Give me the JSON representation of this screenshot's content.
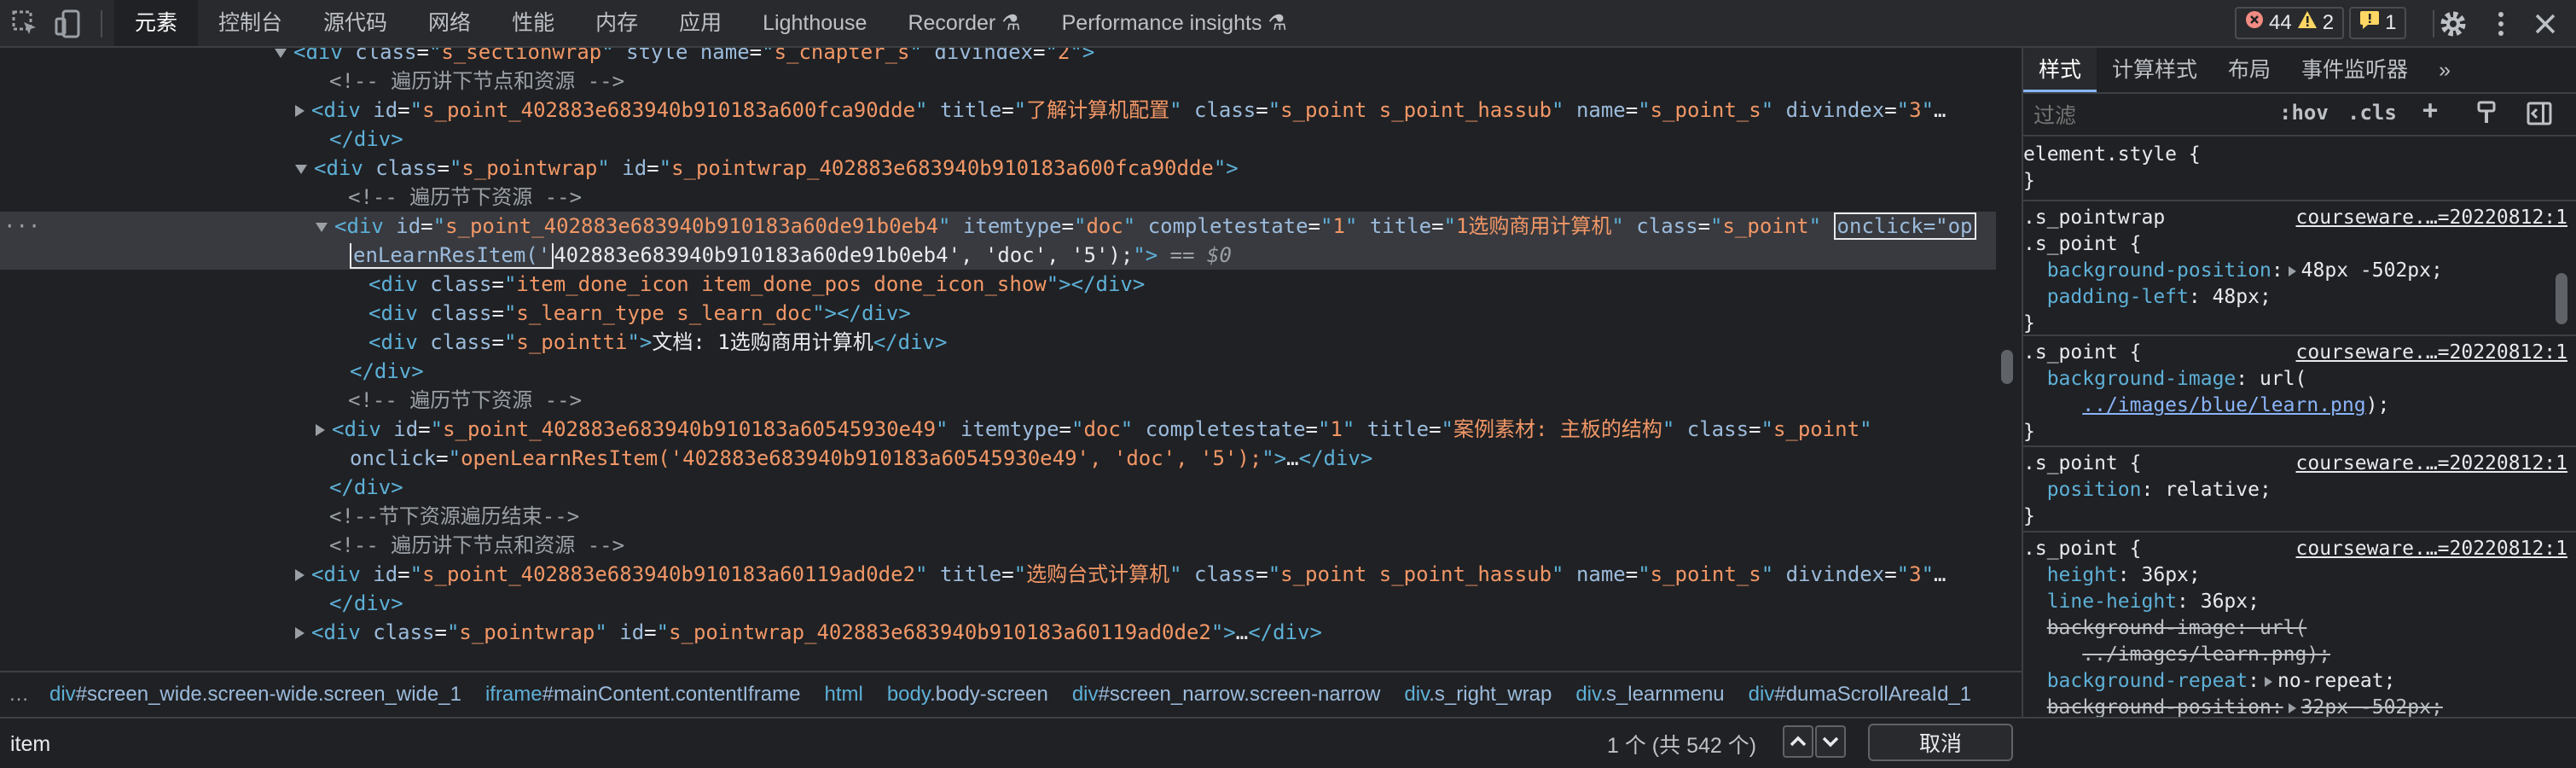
{
  "toolbar": {
    "tabs": [
      "元素",
      "控制台",
      "源代码",
      "网络",
      "性能",
      "内存",
      "应用",
      "Lighthouse",
      "Recorder ⚗",
      "Performance insights ⚗"
    ],
    "errors": "44",
    "warnings": "2",
    "issues": "1"
  },
  "dom": {
    "lines": [
      {
        "indent": 344,
        "tri": "down",
        "html": "<span class='tg'>&lt;div</span> <span class='an'>class</span>=<span class='tg'>\"</span><span class='av'>s_sectionwrap</span><span class='tg'>\"</span> <span class='an'>style name</span>=<span class='tg'>\"</span><span class='av'>s_chapter_s</span><span class='tg'>\"</span> <span class='an'>divindex</span>=<span class='tg'>\"</span><span class='av'>2</span><span class='tg'>\"&gt;</span>"
      },
      {
        "indent": 386,
        "tri": "none",
        "html": "<span class='cm'>&lt;!-- 遍历讲下节点和资源 --&gt;</span>"
      },
      {
        "indent": 368,
        "tri": "right",
        "html": "<span class='tg'>&lt;div</span> <span class='an'>id</span>=<span class='tg'>\"</span><span class='av'>s_point_402883e683940b910183a600fca90dde</span><span class='tg'>\"</span> <span class='an'>title</span>=<span class='tg'>\"</span><span class='av'>了解计算机配置</span><span class='tg'>\"</span> <span class='an'>class</span>=<span class='tg'>\"</span><span class='av'>s_point s_point_hassub</span><span class='tg'>\"</span> <span class='an'>name</span>=<span class='tg'>\"</span><span class='av'>s_point_s</span><span class='tg'>\"</span> <span class='an'>divindex</span>=<span class='tg'>\"</span><span class='av'>3</span><span class='tg'>\"</span>…"
      },
      {
        "indent": 386,
        "tri": "none",
        "html": "<span class='tg'>&lt;/div&gt;</span>"
      },
      {
        "indent": 368,
        "tri": "down",
        "html": "<span class='tg'>&lt;div</span> <span class='an'>class</span>=<span class='tg'>\"</span><span class='av'>s_pointwrap</span><span class='tg'>\"</span> <span class='an'>id</span>=<span class='tg'>\"</span><span class='av'>s_pointwrap_402883e683940b910183a600fca90dde</span><span class='tg'>\"&gt;</span>"
      },
      {
        "indent": 408,
        "tri": "none",
        "html": "<span class='cm'>&lt;!-- 遍历节下资源 --&gt;</span>"
      },
      {
        "indent": 392,
        "tri": "down",
        "sel": true,
        "html": "<span class='tg'>&lt;div</span> <span class='an'>id</span>=<span class='tg'>\"</span><span class='av'>s_point_402883e683940b910183a60de91b0eb4</span><span class='tg'>\"</span> <span class='an'>itemtype</span>=<span class='tg'>\"</span><span class='av'>doc</span><span class='tg'>\"</span> <span class='an'>completestate</span>=<span class='tg'>\"</span><span class='av'>1</span><span class='tg'>\"</span> <span class='an'>title</span>=<span class='tg'>\"</span><span class='av'>1选购商用计算机</span><span class='tg'>\"</span> <span class='an'>class</span>=<span class='tg'>\"</span><span class='av'>s_point</span><span class='tg'>\"</span> <span class='boxed'>onclick=\"op</span>"
      },
      {
        "indent": 410,
        "tri": "none",
        "sel": true,
        "html": "<span class='boxed' style='border-top:none'>enLearnResItem('</span><span class='tx'>402883e683940b910183a60de91b0eb4', 'doc', '5');</span><span class='tg'>\"&gt;</span> <span class='eq'>== $0</span>"
      },
      {
        "indent": 432,
        "tri": "none",
        "html": "<span class='tg'>&lt;div</span> <span class='an'>class</span>=<span class='tg'>\"</span><span class='av'>item_done_icon item_done_pos done_icon_show</span><span class='tg'>\"&gt;&lt;/div&gt;</span>"
      },
      {
        "indent": 432,
        "tri": "none",
        "html": "<span class='tg'>&lt;div</span> <span class='an'>class</span>=<span class='tg'>\"</span><span class='av'>s_learn_type s_learn_doc</span><span class='tg'>\"&gt;&lt;/div&gt;</span>"
      },
      {
        "indent": 432,
        "tri": "none",
        "html": "<span class='tg'>&lt;div</span> <span class='an'>class</span>=<span class='tg'>\"</span><span class='av'>s_pointti</span><span class='tg'>\"&gt;</span><span class='tx'>文档: 1选购商用计算机</span><span class='tg'>&lt;/div&gt;</span>"
      },
      {
        "indent": 410,
        "tri": "none",
        "html": "<span class='tg'>&lt;/div&gt;</span>"
      },
      {
        "indent": 408,
        "tri": "none",
        "html": "<span class='cm'>&lt;!-- 遍历节下资源 --&gt;</span>"
      },
      {
        "indent": 392,
        "tri": "right",
        "html": "<span class='tg'>&lt;div</span> <span class='an'>id</span>=<span class='tg'>\"</span><span class='av'>s_point_402883e683940b910183a60545930e49</span><span class='tg'>\"</span> <span class='an'>itemtype</span>=<span class='tg'>\"</span><span class='av'>doc</span><span class='tg'>\"</span> <span class='an'>completestate</span>=<span class='tg'>\"</span><span class='av'>1</span><span class='tg'>\"</span> <span class='an'>title</span>=<span class='tg'>\"</span><span class='av'>案例素材: 主板的结构</span><span class='tg'>\"</span> <span class='an'>class</span>=<span class='tg'>\"</span><span class='av'>s_point</span><span class='tg'>\"</span>"
      },
      {
        "indent": 410,
        "tri": "none",
        "html": "<span class='an'>onclick</span>=<span class='tg'>\"</span><span class='av'>openLearnResItem('402883e683940b910183a60545930e49', 'doc', '5');</span><span class='tg'>\"&gt;</span>…<span class='tg'>&lt;/div&gt;</span>"
      },
      {
        "indent": 386,
        "tri": "none",
        "html": "<span class='tg'>&lt;/div&gt;</span>"
      },
      {
        "indent": 386,
        "tri": "none",
        "html": "<span class='cm'>&lt;!--节下资源遍历结束--&gt;</span>"
      },
      {
        "indent": 386,
        "tri": "none",
        "html": "<span class='cm'>&lt;!-- 遍历讲下节点和资源 --&gt;</span>"
      },
      {
        "indent": 368,
        "tri": "right",
        "html": "<span class='tg'>&lt;div</span> <span class='an'>id</span>=<span class='tg'>\"</span><span class='av'>s_point_402883e683940b910183a60119ad0de2</span><span class='tg'>\"</span> <span class='an'>title</span>=<span class='tg'>\"</span><span class='av'>选购台式计算机</span><span class='tg'>\"</span> <span class='an'>class</span>=<span class='tg'>\"</span><span class='av'>s_point s_point_hassub</span><span class='tg'>\"</span> <span class='an'>name</span>=<span class='tg'>\"</span><span class='av'>s_point_s</span><span class='tg'>\"</span> <span class='an'>divindex</span>=<span class='tg'>\"</span><span class='av'>3</span><span class='tg'>\"</span>…"
      },
      {
        "indent": 386,
        "tri": "none",
        "html": "<span class='tg'>&lt;/div&gt;</span>"
      },
      {
        "indent": 368,
        "tri": "right",
        "html": "<span class='tg'>&lt;div</span> <span class='an'>class</span>=<span class='tg'>\"</span><span class='av'>s_pointwrap</span><span class='tg'>\"</span> <span class='an'>id</span>=<span class='tg'>\"</span><span class='av'>s_pointwrap_402883e683940b910183a60119ad0de2</span><span class='tg'>\"&gt;</span>…<span class='tg'>&lt;/div&gt;</span>"
      }
    ]
  },
  "breadcrumbs": [
    {
      "tag": "div",
      "rest": "#screen_wide.screen-wide.screen_wide_1"
    },
    {
      "tag": "iframe",
      "rest": "#mainContent.contentIframe"
    },
    {
      "tag": "html",
      "rest": ""
    },
    {
      "tag": "body",
      "rest": ".body-screen"
    },
    {
      "tag": "div",
      "rest": "#screen_narrow.screen-narrow"
    },
    {
      "tag": "div",
      "rest": ".s_right_wrap"
    },
    {
      "tag": "div",
      "rest": ".s_learnmenu"
    },
    {
      "tag": "div",
      "rest": "#dumaScrollAreaId_1"
    }
  ],
  "search": {
    "value": "item",
    "match": "1 个 (共 542 个)",
    "cancel": "取消"
  },
  "styles": {
    "tabs": [
      "样式",
      "计算样式",
      "布局",
      "事件监听器",
      "»"
    ],
    "filter_placeholder": "过滤",
    "hov": ":hov",
    "cls": ".cls",
    "element_style": "element.style {",
    "src": "courseware.…=20220812:1"
  }
}
